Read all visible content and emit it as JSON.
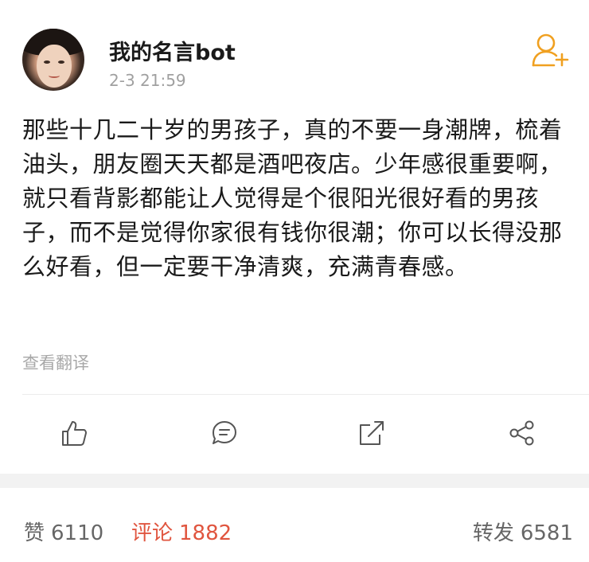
{
  "post": {
    "username": "我的名言bot",
    "timestamp": "2-3 21:59",
    "content": "那些十几二十岁的男孩子，真的不要一身潮牌，梳着油头，朋友圈天天都是酒吧夜店。少年感很重要啊，就只看背影都能让人觉得是个很阳光很好看的男孩子，而不是觉得你家很有钱你很潮；你可以长得没那么好看，但一定要干净清爽，充满青春感。",
    "translate_label": "查看翻译"
  },
  "actions": {
    "like_icon": "thumbs-up-icon",
    "comment_icon": "comment-icon",
    "repost_icon": "repost-icon",
    "share_icon": "share-icon"
  },
  "stats": {
    "likes_label": "赞",
    "likes_count": "6110",
    "comments_label": "评论",
    "comments_count": "1882",
    "reposts_label": "转发",
    "reposts_count": "6581"
  },
  "colors": {
    "accent": "#e0553f",
    "follow": "#f0a020",
    "muted": "#a0a0a0"
  }
}
